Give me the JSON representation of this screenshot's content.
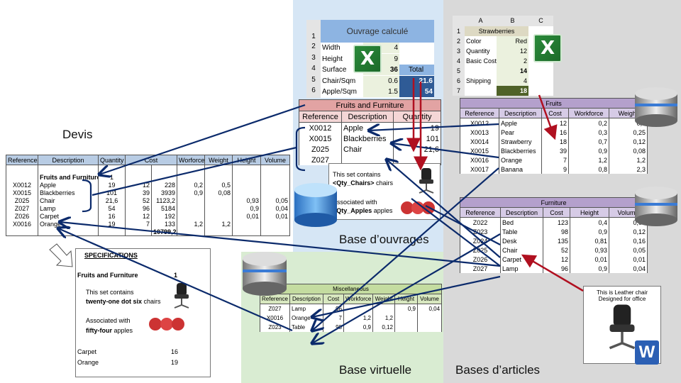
{
  "labels": {
    "devis": "Devis",
    "base_ouvrages": "Base d’ouvrages",
    "base_virtuelle": "Base virtuelle",
    "bases_articles": "Bases d’articles"
  },
  "colors": {
    "arrow_navy": "#0b2a6b",
    "arrow_red": "#b01020",
    "blue_zone": "#d6e6f5",
    "green_zone": "#d9ecd2",
    "gray_zone": "#d9d9d9"
  },
  "icons": [
    "excel-icon",
    "word-icon",
    "database-icon",
    "chair-image",
    "apples-image"
  ],
  "devis": {
    "headers": [
      "Reference",
      "Description",
      "Quantity",
      "Cost",
      "Worforce",
      "Weight",
      "Height",
      "Volume"
    ],
    "rows": [
      [
        "",
        "",
        "",
        "",
        "",
        "",
        "",
        "",
        ""
      ],
      [
        "",
        "Fruits and Furniture",
        "1",
        "",
        "",
        "",
        "",
        "",
        ""
      ],
      [
        "X0012",
        "Apple",
        "19",
        "12",
        "228",
        "0,2",
        "0,5",
        "",
        ""
      ],
      [
        "X0015",
        "Blackberries",
        "101",
        "39",
        "3939",
        "0,9",
        "0,08",
        "",
        ""
      ],
      [
        "Z025",
        "Chair",
        "21,6",
        "52",
        "1123,2",
        "",
        "",
        "0,93",
        "0,05"
      ],
      [
        "Z027",
        "Lamp",
        "54",
        "96",
        "5184",
        "",
        "",
        "0,9",
        "0,04"
      ],
      [
        "Z026",
        "Carpet",
        "16",
        "12",
        "192",
        "",
        "",
        "0,01",
        "0,01"
      ],
      [
        "X0016",
        "Orange",
        "19",
        "7",
        "133",
        "1,2",
        "1,2",
        "",
        ""
      ],
      [
        "",
        "",
        "",
        "",
        "10799,2",
        "",
        "",
        "",
        ""
      ]
    ]
  },
  "ouvrage": {
    "title": "Ouvrage calculé",
    "row_numbers": [
      "1",
      "2",
      "3",
      "4",
      "5",
      "6"
    ],
    "rows": [
      [
        "Width",
        "4",
        ""
      ],
      [
        "Height",
        "9",
        ""
      ],
      [
        "Surface",
        "36",
        "Total"
      ],
      [
        "Chair/Sqm",
        "0.6",
        "21.6"
      ],
      [
        "Apple/Sqm",
        "1.5",
        "54"
      ]
    ]
  },
  "strawberries": {
    "col_headers": [
      "A",
      "B",
      "C"
    ],
    "row_numbers": [
      "1",
      "2",
      "3",
      "4",
      "5",
      "6",
      "7"
    ],
    "title": "Strawberries",
    "rows": [
      [
        "Color",
        "Red"
      ],
      [
        "Quantity",
        "12"
      ],
      [
        "Basic Cost",
        "2"
      ],
      [
        "",
        "14"
      ],
      [
        "Shipping",
        "4"
      ],
      [
        "",
        "18"
      ]
    ]
  },
  "fruits_furniture": {
    "title": "Fruits and Furniture",
    "headers": [
      "Reference",
      "Description",
      "Quantity"
    ],
    "rows": [
      [
        "X0012",
        "Apple",
        "19"
      ],
      [
        "X0015",
        "Blackberries",
        "101"
      ],
      [
        "Z025",
        "Chair",
        "21,6"
      ],
      [
        "Z027",
        "",
        ""
      ]
    ]
  },
  "popup": {
    "line1": "This set contains",
    "var1": "<Qty_Chairs>",
    "word1": "chairs",
    "line2": "Associated with",
    "var2": "<Qty_Apples",
    "word2": "apples"
  },
  "fruits": {
    "title": "Fruits",
    "headers": [
      "Reference",
      "Description",
      "Cost",
      "Workforce",
      "Weight"
    ],
    "rows": [
      [
        "X0012",
        "Apple",
        "12",
        "0,2",
        "0,5"
      ],
      [
        "X0013",
        "Pear",
        "16",
        "0,3",
        "0,25"
      ],
      [
        "X0014",
        "Strawberry",
        "18",
        "0,7",
        "0,12"
      ],
      [
        "X0015",
        "Blackberries",
        "39",
        "0,9",
        "0,08"
      ],
      [
        "X0016",
        "Orange",
        "7",
        "1,2",
        "1,2"
      ],
      [
        "X0017",
        "Banana",
        "9",
        "0,8",
        "2,3"
      ]
    ]
  },
  "furniture": {
    "title": "Furniture",
    "headers": [
      "Reference",
      "Description",
      "Cost",
      "Height",
      "Volume"
    ],
    "rows": [
      [
        "Z022",
        "Bed",
        "123",
        "0,4",
        "0,06"
      ],
      [
        "Z023",
        "Table",
        "98",
        "0,9",
        "0,12"
      ],
      [
        "Z024",
        "Desk",
        "135",
        "0,81",
        "0,16"
      ],
      [
        "Z025",
        "Chair",
        "52",
        "0,93",
        "0,05"
      ],
      [
        "Z026",
        "Carpet",
        "12",
        "0,01",
        "0,01"
      ],
      [
        "Z027",
        "Lamp",
        "96",
        "0,9",
        "0,04"
      ]
    ]
  },
  "misc": {
    "title": "Miscellaneous",
    "headers": [
      "Reference",
      "Description",
      "Cost",
      "Workforce",
      "Weight",
      "Height",
      "Volume"
    ],
    "rows": [
      [
        "Z027",
        "Lamp",
        "96",
        "",
        "",
        "0,9",
        "0,04"
      ],
      [
        "X0016",
        "Orange",
        "7",
        "1,2",
        "1,2",
        "",
        ""
      ],
      [
        "Z023",
        "Table",
        "98",
        "0,9",
        "0,12",
        "",
        ""
      ]
    ]
  },
  "specs": {
    "title": "SPECIFICATIONS",
    "set": "Fruits and Furniture",
    "set_qty": "1",
    "line1": "This set contains",
    "num1": "twenty-one dot six",
    "word1": "chairs",
    "line2": "Associated with",
    "num2": "fifty-four",
    "word2": "apples",
    "items": [
      [
        "Carpet",
        "16"
      ],
      [
        "Orange",
        "19"
      ]
    ]
  },
  "note": {
    "line1": "This is Leather chair",
    "line2": "Designed for office"
  }
}
